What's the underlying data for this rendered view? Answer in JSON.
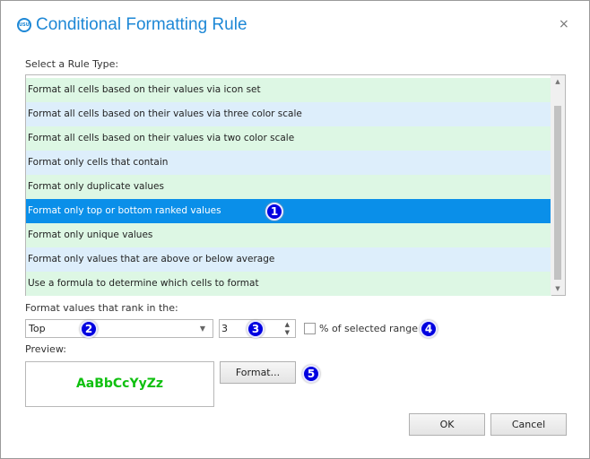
{
  "dialog": {
    "title": "Conditional Formatting Rule",
    "logo": "USU",
    "close": "×"
  },
  "rule_type_label": "Select a Rule Type:",
  "rules": [
    {
      "label": "Format all cells based on their values via icon set",
      "color": "green"
    },
    {
      "label": "Format all cells based on their values via three color scale",
      "color": "blue"
    },
    {
      "label": "Format all cells based on their values via two color scale",
      "color": "green"
    },
    {
      "label": "Format only cells that contain",
      "color": "blue"
    },
    {
      "label": "Format only duplicate values",
      "color": "green"
    },
    {
      "label": "Format only top or bottom ranked values",
      "color": "blue",
      "selected": true
    },
    {
      "label": "Format only unique values",
      "color": "green"
    },
    {
      "label": "Format only values that are above or below average",
      "color": "blue"
    },
    {
      "label": "Use a formula to determine which cells to format",
      "color": "green"
    }
  ],
  "rank_label": "Format values that rank in the:",
  "rank_select": "Top",
  "rank_count": "3",
  "percent_label": "% of selected range",
  "percent_checked": false,
  "preview_label": "Preview:",
  "preview_text": "AaBbCcYyZz",
  "format_button": "Format...",
  "ok_button": "OK",
  "cancel_button": "Cancel",
  "badges": [
    "1",
    "2",
    "3",
    "4",
    "5"
  ],
  "colors": {
    "accent": "#1e88d6",
    "selected_row": "#0a8fe9",
    "preview_text": "#10c010",
    "badge": "#0000e0"
  }
}
